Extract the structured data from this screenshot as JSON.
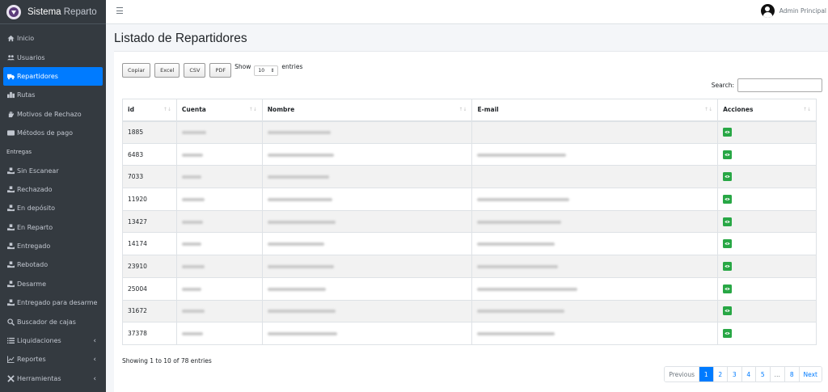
{
  "brand": {
    "name_bold": "Sistema",
    "name_light": "Reparto"
  },
  "topbar": {
    "user_name": "Admin Principal"
  },
  "sidebar": {
    "items": [
      {
        "label": "Inicio",
        "icon": "home-icon"
      },
      {
        "label": "Usuarios",
        "icon": "users-icon"
      },
      {
        "label": "Repartidores",
        "icon": "truck-icon",
        "active": true
      },
      {
        "label": "Rutas",
        "icon": "route-icon"
      },
      {
        "label": "Motivos de Rechazo",
        "icon": "hand-icon"
      },
      {
        "label": "Métodos de pago",
        "icon": "card-icon"
      }
    ],
    "section_header": "Entregas",
    "entregas": [
      {
        "label": "Sin Escanear",
        "icon": "box-hand-icon"
      },
      {
        "label": "Rechazado",
        "icon": "box-hand-icon"
      },
      {
        "label": "En depósito",
        "icon": "box-hand-icon"
      },
      {
        "label": "En Reparto",
        "icon": "box-hand-icon"
      },
      {
        "label": "Entregado",
        "icon": "box-hand-icon"
      },
      {
        "label": "Rebotado",
        "icon": "box-hand-icon"
      },
      {
        "label": "Desarme",
        "icon": "box-hand-icon"
      },
      {
        "label": "Entregado para desarme",
        "icon": "box-hand-icon"
      },
      {
        "label": "Buscador de cajas",
        "icon": "search-icon"
      },
      {
        "label": "Liquidaciones",
        "icon": "list-icon"
      },
      {
        "label": "Reportes",
        "icon": "chart-icon"
      },
      {
        "label": "Herramientas",
        "icon": "tools-icon"
      }
    ]
  },
  "page": {
    "title": "Listado de Repartidores"
  },
  "toolbar": {
    "copy": "Copiar",
    "excel": "Excel",
    "csv": "CSV",
    "pdf": "PDF",
    "show_label": "Show",
    "entries_value": "10",
    "entries_label": "entries",
    "search_label": "Search:"
  },
  "table": {
    "headers": {
      "id": "id",
      "cuenta": "Cuenta",
      "nombre": "Nombre",
      "email": "E-mail",
      "acciones": "Acciones"
    },
    "rows": [
      {
        "id": "1885",
        "has_email": false
      },
      {
        "id": "6483",
        "has_email": true
      },
      {
        "id": "7033",
        "has_email": false
      },
      {
        "id": "11920",
        "has_email": true
      },
      {
        "id": "13427",
        "has_email": true
      },
      {
        "id": "14174",
        "has_email": true
      },
      {
        "id": "23910",
        "has_email": true
      },
      {
        "id": "25004",
        "has_email": true
      },
      {
        "id": "31672",
        "has_email": true
      },
      {
        "id": "37378",
        "has_email": true
      }
    ]
  },
  "footer": {
    "info": "Showing 1 to 10 of 78 entries",
    "pagination": [
      "Previous",
      "1",
      "2",
      "3",
      "4",
      "5",
      "…",
      "8",
      "Next"
    ],
    "active_page": "1"
  },
  "colors": {
    "sidebar_bg": "#343a40",
    "accent": "#007bff",
    "action_green": "#28a745"
  }
}
